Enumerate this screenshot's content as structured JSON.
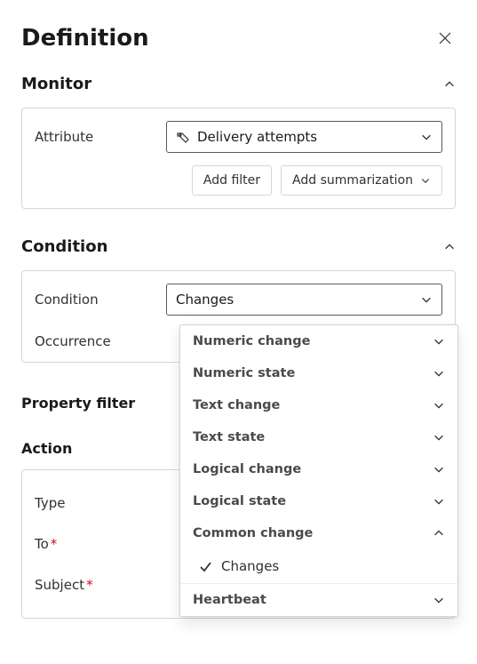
{
  "header": {
    "title": "Definition"
  },
  "monitor": {
    "heading": "Monitor",
    "attribute_label": "Attribute",
    "attribute_value": "Delivery attempts",
    "add_filter_label": "Add filter",
    "add_summarization_label": "Add summarization"
  },
  "condition": {
    "heading": "Condition",
    "condition_label": "Condition",
    "condition_value": "Changes",
    "occurrence_label": "Occurrence"
  },
  "condition_dropdown": {
    "groups": [
      {
        "label": "Numeric change",
        "expanded": false
      },
      {
        "label": "Numeric state",
        "expanded": false
      },
      {
        "label": "Text change",
        "expanded": false
      },
      {
        "label": "Text state",
        "expanded": false
      },
      {
        "label": "Logical change",
        "expanded": false
      },
      {
        "label": "Logical state",
        "expanded": false
      },
      {
        "label": "Common change",
        "expanded": true,
        "items": [
          {
            "label": "Changes",
            "selected": true
          }
        ]
      },
      {
        "label": "Heartbeat",
        "expanded": false
      }
    ]
  },
  "property_filter": {
    "heading": "Property filter"
  },
  "action": {
    "heading": "Action",
    "type_label": "Type",
    "to_label": "To",
    "subject_label": "Subject"
  }
}
